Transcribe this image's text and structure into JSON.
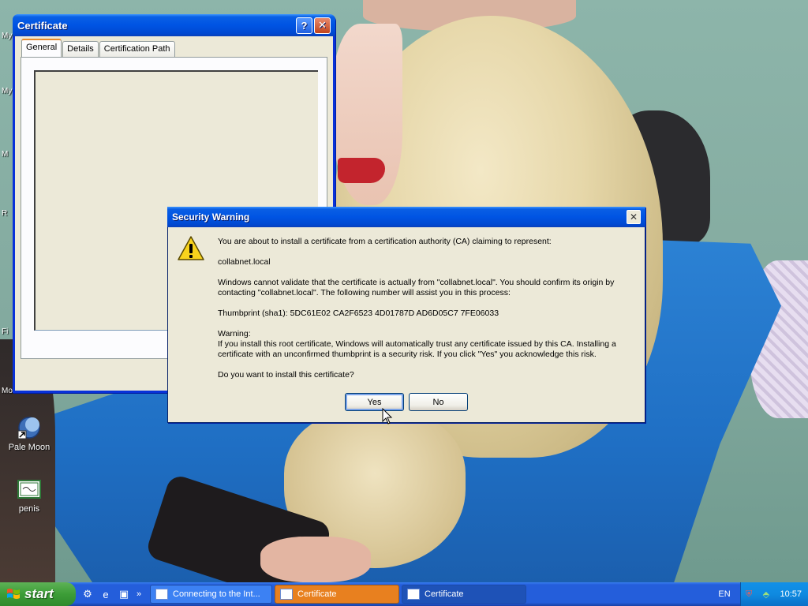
{
  "desktop": {
    "edge_labels": [
      "My",
      "My",
      "M",
      "R",
      "Fi",
      "Mo"
    ],
    "icons": [
      {
        "label": "Pale Moon",
        "icon": "pale-moon-icon"
      },
      {
        "label": "penis",
        "icon": "certificate-file-icon"
      }
    ]
  },
  "certificate_window": {
    "title": "Certificate",
    "tabs": [
      "General",
      "Details",
      "Certification Path"
    ],
    "active_tab": "General"
  },
  "security_warning": {
    "title": "Security Warning",
    "intro": "You are about to install a certificate from a certification authority (CA) claiming to represent:",
    "domain": "collabnet.local",
    "validate_text": "Windows cannot validate that the certificate is actually from \"collabnet.local\". You should confirm its origin by contacting \"collabnet.local\". The following number will assist you in this process:",
    "thumbprint": "Thumbprint (sha1): 5DC61E02 CA2F6523 4D01787D AD6D05C7 7FE06033",
    "warning_heading": "Warning:",
    "warning_text": "If you install this root certificate, Windows will automatically trust any certificate issued by this CA. Installing a certificate with an unconfirmed thumbprint is a security risk. If you click \"Yes\" you acknowledge this risk.",
    "question": "Do you want to install this certificate?",
    "yes_label": "Yes",
    "no_label": "No"
  },
  "taskbar": {
    "start_label": "start",
    "overflow": "»",
    "tasks": [
      {
        "label": "Connecting to the Int...",
        "state": "normal"
      },
      {
        "label": "Certificate",
        "state": "active"
      },
      {
        "label": "Certificate",
        "state": "normal"
      }
    ],
    "language": "EN",
    "clock": "10:57"
  },
  "colors": {
    "titlebar_blue": "#0054e3",
    "start_green": "#3c9d37",
    "taskbar_blue": "#245edb",
    "active_task_orange": "#e8801f",
    "dialog_face": "#ece9d8"
  }
}
